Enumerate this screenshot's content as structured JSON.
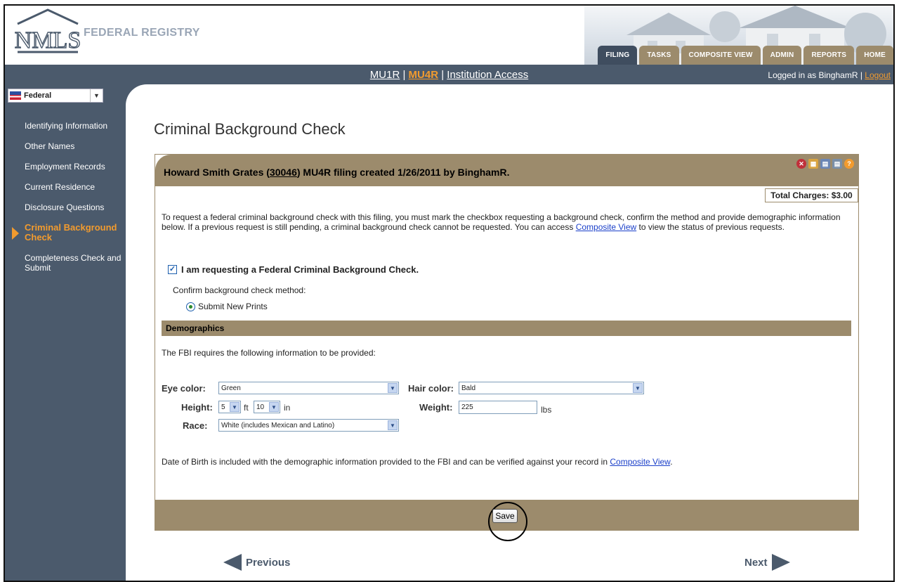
{
  "header": {
    "brand": "FEDERAL REGISTRY",
    "logo_text": "NMLS",
    "tabs": [
      {
        "label": "FILING",
        "active": true
      },
      {
        "label": "TASKS",
        "active": false
      },
      {
        "label": "COMPOSITE VIEW",
        "active": false
      },
      {
        "label": "ADMIN",
        "active": false
      },
      {
        "label": "REPORTS",
        "active": false
      },
      {
        "label": "HOME",
        "active": false
      }
    ]
  },
  "navbar": {
    "links": [
      "MU1R",
      "MU4R",
      "Institution Access"
    ],
    "separator": " | ",
    "current": "MU4R",
    "login_prefix": "Logged in as BinghamR",
    "logout": "Logout"
  },
  "sidebar": {
    "jurisdiction": "Federal",
    "items": [
      {
        "label": "Identifying Information",
        "active": false
      },
      {
        "label": "Other Names",
        "active": false
      },
      {
        "label": "Employment Records",
        "active": false
      },
      {
        "label": "Current Residence",
        "active": false
      },
      {
        "label": "Disclosure Questions",
        "active": false
      },
      {
        "label": "Criminal Background Check",
        "active": true
      },
      {
        "label": "Completeness Check and Submit",
        "active": false
      }
    ]
  },
  "main": {
    "page_title": "Criminal Background Check",
    "filing_header": {
      "prefix": "Howard Smith Grates (",
      "id": "30046",
      "suffix": ") MU4R filing created 1/26/2011 by BinghamR."
    },
    "total_charges": "Total Charges: $3.00",
    "intro": {
      "text": "To request a federal criminal background check with this filing, you must mark the checkbox requesting a background check, confirm the method and provide demographic information below. If a previous request is still pending, a criminal background check cannot be requested. You can access ",
      "link": "Composite View",
      "text_after": " to view the status of previous requests."
    },
    "request_checkbox": {
      "label": "I am requesting a Federal Criminal Background Check.",
      "checked": true
    },
    "confirm_label": "Confirm background check method:",
    "method_option": {
      "label": "Submit New Prints",
      "selected": true
    },
    "demographics": {
      "section_title": "Demographics",
      "fbi_text": "The FBI requires the following information to be provided:",
      "eye_color_label": "Eye color:",
      "eye_color": "Green",
      "hair_color_label": "Hair color:",
      "hair_color": "Bald",
      "height_label": "Height:",
      "height_ft": "5",
      "ft_unit": "ft",
      "height_in": "10",
      "in_unit": "in",
      "weight_label": "Weight:",
      "weight": "225",
      "weight_unit": "lbs",
      "race_label": "Race:",
      "race": "White (includes Mexican and Latino)"
    },
    "dob": {
      "text": "Date of Birth is included with the demographic information provided to the FBI and can be verified against your record in ",
      "link": "Composite View",
      "text_after": "."
    },
    "save_label": "Save",
    "prev_label": "Previous",
    "next_label": "Next"
  },
  "colors": {
    "nav_bg": "#4b5a6c",
    "accent_orange": "#f29b2e",
    "panel_tan": "#9c8b6c",
    "link_blue": "#1a3fc9"
  }
}
